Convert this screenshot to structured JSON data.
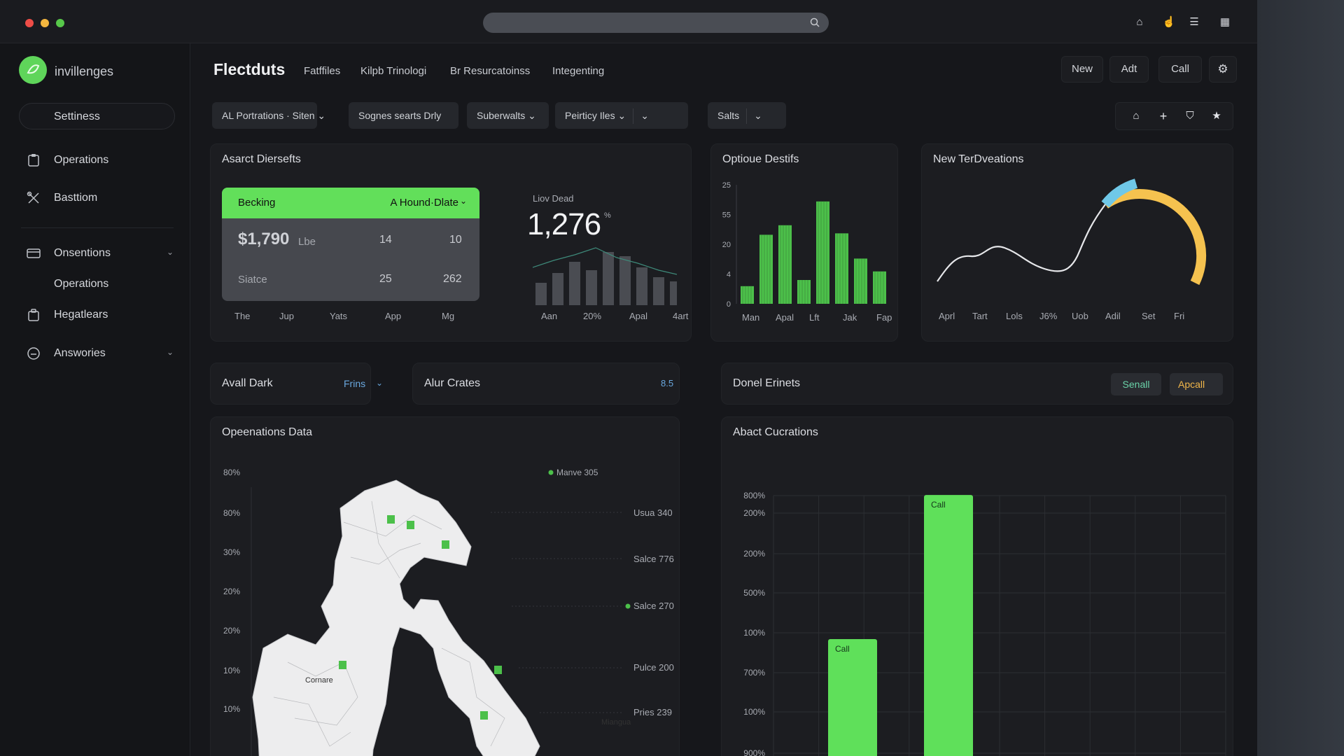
{
  "window": {
    "search_placeholder": ""
  },
  "sidebar": {
    "brand": "invillenges",
    "search": "Settiness",
    "items": [
      {
        "label": "Operations",
        "icon": "clipboard-icon"
      },
      {
        "label": "Basttiom",
        "icon": "tools-icon"
      },
      {
        "label": "Onsentions",
        "icon": "card-icon"
      },
      {
        "label": "Operations",
        "icon": ""
      },
      {
        "label": "Hegatlears",
        "icon": "briefcase-icon"
      },
      {
        "label": "Answories",
        "icon": "chat-icon"
      }
    ]
  },
  "header": {
    "title": "Flectduts",
    "tabs": [
      "Fatffiles",
      "Kilpb Trinologi",
      "Br Resurcatoinss",
      "Integenting"
    ],
    "buttons": [
      "New",
      "Adt",
      "Call"
    ]
  },
  "filters": {
    "f1": "AL Portrations · Siten",
    "f2": "Sognes searts Drly",
    "f3": "Suberwalts",
    "f4": "Peirticy Iles",
    "f5": "Salts"
  },
  "card1": {
    "title": "Asarct Diersefts",
    "green_label": "Becking",
    "green_dropdown": "A Hound·Dlate",
    "amount": "$1,790",
    "amount_suffix": "Lbe",
    "r1a": "14",
    "r1b": "10",
    "row2_label": "Siatce",
    "r2a": "25",
    "r2b": "262",
    "kpi_label": "Liov Dead",
    "kpi_value": "1,276",
    "kpi_suffix": "%",
    "xlabels_left": [
      "The",
      "Jup",
      "Yats",
      "App",
      "Mg"
    ],
    "xlabels_right": [
      "Aan",
      "20%",
      "Apal",
      "4art"
    ]
  },
  "card2": {
    "title": "Optioue Destifs",
    "chart_data": {
      "type": "bar",
      "categories": [
        "Man",
        "Apal",
        "Lft",
        "Jak",
        "Fap"
      ],
      "yticks": [
        "25",
        "55",
        "20",
        "4",
        "0"
      ],
      "series": [
        {
          "values": [
            3.7,
            14.5,
            16.5,
            5,
            21.5,
            14.8,
            9.5,
            6.8
          ]
        }
      ],
      "color": "#4cc04a"
    }
  },
  "card3": {
    "title": "New TerDveations",
    "xlabels": [
      "Aprl",
      "Tart",
      "Lols",
      "J6%",
      "Uob",
      "Adil",
      "Set",
      "Fri"
    ],
    "colors": {
      "line": "#e6e7ea",
      "gauge": "#f5c24f",
      "gauge_accent": "#6fc8e8"
    }
  },
  "row2": {
    "c1_title": "Avall Dark",
    "c1_link": "Frins",
    "c2_title": "Alur Crates",
    "c2_value": "8.5",
    "c3_title": "Donel Erinets",
    "c3_btn1": "Senall",
    "c3_btn2": "Apcall"
  },
  "map_card": {
    "title": "Opeenations Data",
    "yticks": [
      "80%",
      "80%",
      "30%",
      "20%",
      "20%",
      "10%",
      "10%"
    ],
    "labels": [
      {
        "text": "Manve 305",
        "dot": true
      },
      {
        "text": "Usua 340",
        "dot": false
      },
      {
        "text": "Salce 776",
        "dot": false
      },
      {
        "text": "Salce 270",
        "dot": true
      },
      {
        "text": "Pulce 200",
        "dot": false
      },
      {
        "text": "Pries 239",
        "dot": false
      }
    ],
    "places": [
      "Cornare",
      "Miangua"
    ]
  },
  "bar_card": {
    "title": "Abact Cucrations",
    "chart_data": {
      "type": "bar",
      "yticks": [
        "800%",
        "200%",
        "200%",
        "500%",
        "100%",
        "700%",
        "100%",
        "900%"
      ],
      "bars": [
        {
          "label": "Call",
          "value": 120
        },
        {
          "label": "Call",
          "value": 255
        }
      ],
      "color": "#5fe05a"
    }
  }
}
